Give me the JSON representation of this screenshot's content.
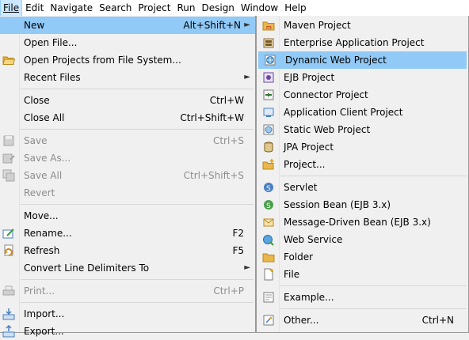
{
  "menubar": [
    "File",
    "Edit",
    "Navigate",
    "Search",
    "Project",
    "Run",
    "Design",
    "Window",
    "Help"
  ],
  "file_menu": {
    "new": {
      "label": "New",
      "accel": "Alt+Shift+N"
    },
    "open_file": {
      "label": "Open File..."
    },
    "open_projects": {
      "label": "Open Projects from File System..."
    },
    "recent_files": {
      "label": "Recent Files"
    },
    "close": {
      "label": "Close",
      "accel": "Ctrl+W"
    },
    "close_all": {
      "label": "Close All",
      "accel": "Ctrl+Shift+W"
    },
    "save": {
      "label": "Save",
      "accel": "Ctrl+S"
    },
    "save_as": {
      "label": "Save As..."
    },
    "save_all": {
      "label": "Save All",
      "accel": "Ctrl+Shift+S"
    },
    "revert": {
      "label": "Revert"
    },
    "move": {
      "label": "Move..."
    },
    "rename": {
      "label": "Rename...",
      "accel": "F2"
    },
    "refresh": {
      "label": "Refresh",
      "accel": "F5"
    },
    "convert": {
      "label": "Convert Line Delimiters To"
    },
    "print": {
      "label": "Print...",
      "accel": "Ctrl+P"
    },
    "import": {
      "label": "Import..."
    },
    "export": {
      "label": "Export..."
    }
  },
  "new_menu": {
    "maven_project": {
      "label": "Maven Project"
    },
    "enterprise_app": {
      "label": "Enterprise Application Project"
    },
    "dynamic_web": {
      "label": "Dynamic Web Project"
    },
    "ejb_project": {
      "label": "EJB Project"
    },
    "connector_project": {
      "label": "Connector Project"
    },
    "app_client": {
      "label": "Application Client Project"
    },
    "static_web": {
      "label": "Static Web Project"
    },
    "jpa_project": {
      "label": "JPA Project"
    },
    "project": {
      "label": "Project..."
    },
    "servlet": {
      "label": "Servlet"
    },
    "session_bean": {
      "label": "Session Bean (EJB 3.x)"
    },
    "mdb": {
      "label": "Message-Driven Bean (EJB 3.x)"
    },
    "web_service": {
      "label": "Web Service"
    },
    "folder": {
      "label": "Folder"
    },
    "file": {
      "label": "File"
    },
    "example": {
      "label": "Example..."
    },
    "other": {
      "label": "Other...",
      "accel": "Ctrl+N"
    }
  },
  "colors": {
    "highlight": "#91c9f7",
    "menu_bg": "#f0f0f0",
    "disabled_text": "#8d8d8d"
  }
}
